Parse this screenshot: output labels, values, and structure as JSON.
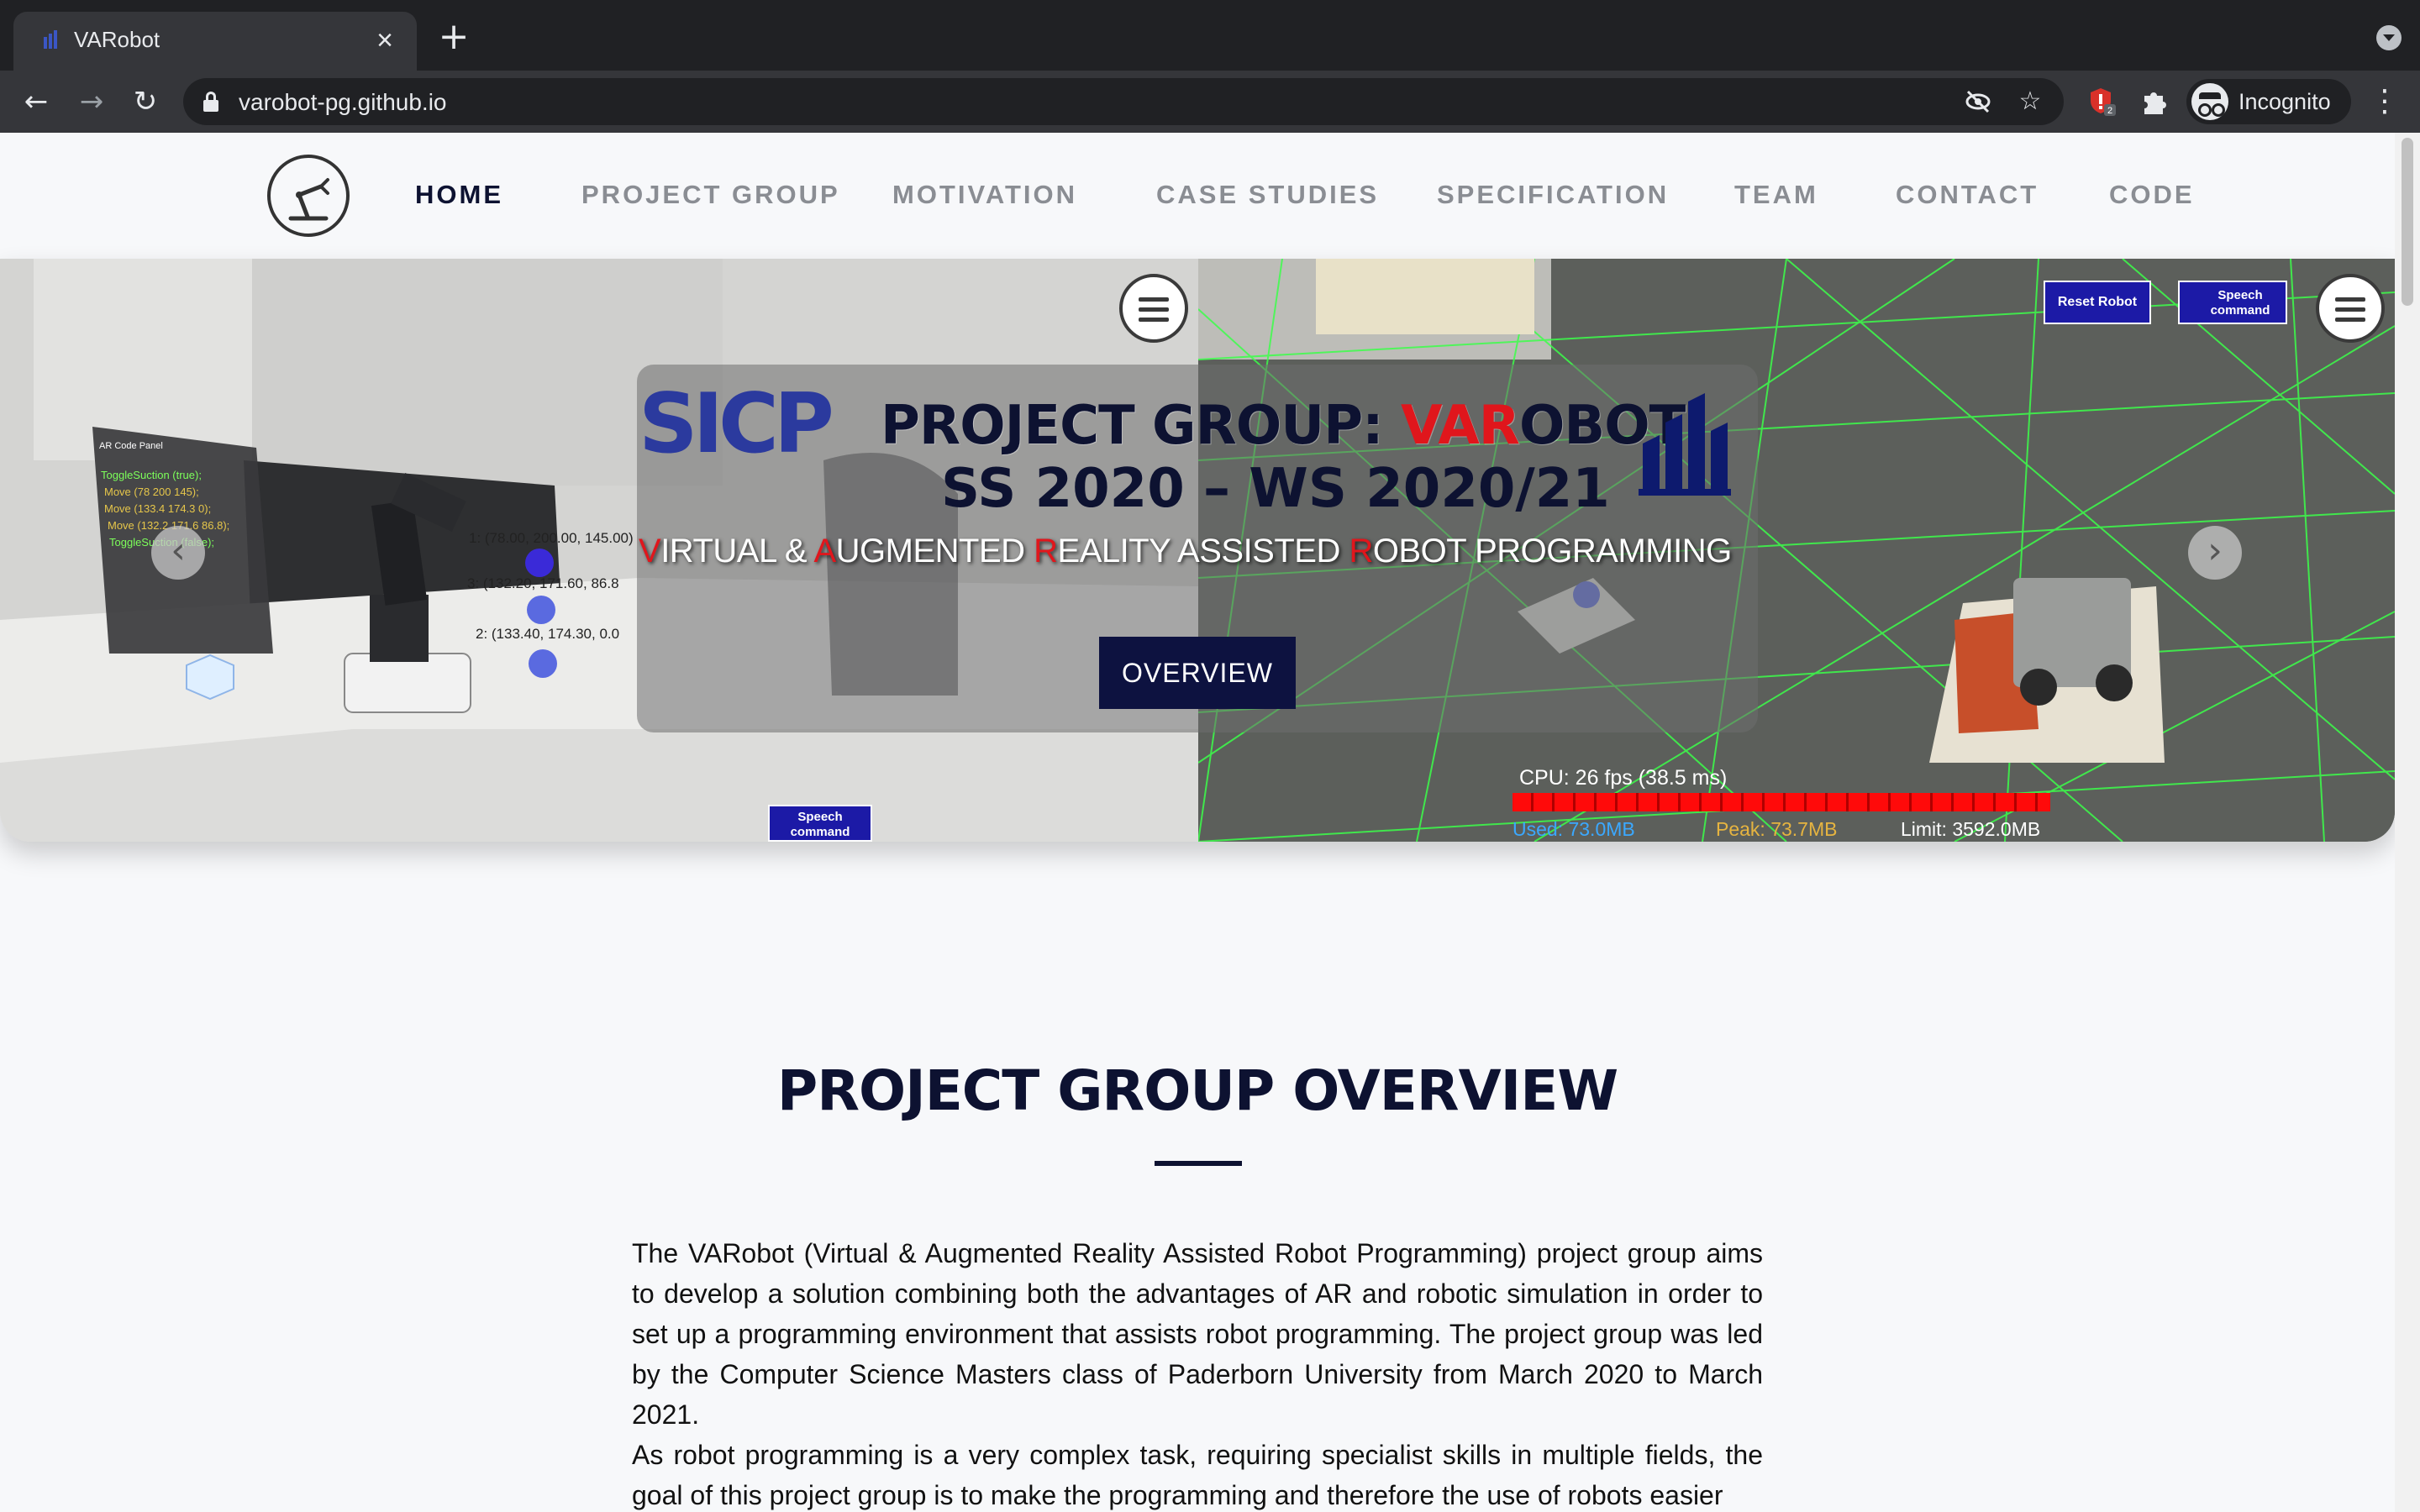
{
  "browser": {
    "tab_title": "VARobot",
    "url": "varobot-pg.github.io",
    "incognito_label": "Incognito",
    "extension_badge": "2",
    "icons": [
      "back-icon",
      "forward-icon",
      "reload-icon",
      "lock-icon",
      "eye-off-icon",
      "star-icon",
      "extension-icon",
      "puzzle-icon",
      "incognito-icon",
      "menu-icon"
    ]
  },
  "nav": {
    "items": [
      {
        "label": "HOME",
        "active": true
      },
      {
        "label": "PROJECT GROUP",
        "active": false
      },
      {
        "label": "MOTIVATION",
        "active": false
      },
      {
        "label": "CASE STUDIES",
        "active": false
      },
      {
        "label": "SPECIFICATION",
        "active": false
      },
      {
        "label": "TEAM",
        "active": false
      },
      {
        "label": "CONTACT",
        "active": false
      },
      {
        "label": "CODE",
        "active": false
      }
    ]
  },
  "hero": {
    "sicp_logo": "SICP",
    "title_prefix": "PROJECT GROUP: ",
    "title_red": "VAR",
    "title_suffix": "OBOT",
    "subtitle": "SS 2020 – WS 2020/21",
    "tagline": [
      {
        "cap": "V",
        "rest": "IRTUAL & "
      },
      {
        "cap": "A",
        "rest": "UGMENTED "
      },
      {
        "cap": "R",
        "rest": "EALITY ASSISTED "
      },
      {
        "cap": "R",
        "rest": "OBOT PROGRAMMING"
      }
    ],
    "button_label": "OVERVIEW",
    "left_overlay": {
      "panel_title": "AR Code Panel",
      "panel_lines": [
        "ToggleSuction (true);",
        "Move (78 200 145);",
        "Move (133.4 174.3 0);",
        "Move (132.2 171.6 86.8);",
        "ToggleSuction (false);"
      ],
      "waypoints": [
        "1: (78.00, 200.00, 145.00)",
        "3: (132.20, 171.60, 86.8",
        "2: (133.40, 174.30, 0.0"
      ],
      "speech_button": "Speech command"
    },
    "right_overlay": {
      "reset_button": "Reset Robot",
      "speech_button": "Speech command",
      "cpu_label": "CPU: 26 fps (38.5 ms)",
      "used": "Used: 73.0MB",
      "peak": "Peak: 73.7MB",
      "limit": "Limit: 3592.0MB"
    },
    "colors": {
      "navy": "#0d1231",
      "red": "#e0161c",
      "grid_green": "#3cff4a"
    }
  },
  "overview": {
    "title": "PROJECT GROUP OVERVIEW",
    "paragraphs": [
      "The VARobot (Virtual & Augmented Reality Assisted Robot Programming) project group aims to develop a solution combining both the advantages of AR and robotic simulation in order to set up a programming environment that assists robot programming. The project group was led by the Computer Science Masters class of Paderborn University from March 2020 to March 2021.",
      "As robot programming is a very complex task, requiring specialist skills in multiple fields, the goal of this project group is to make the programming and therefore the use of robots easier"
    ]
  }
}
